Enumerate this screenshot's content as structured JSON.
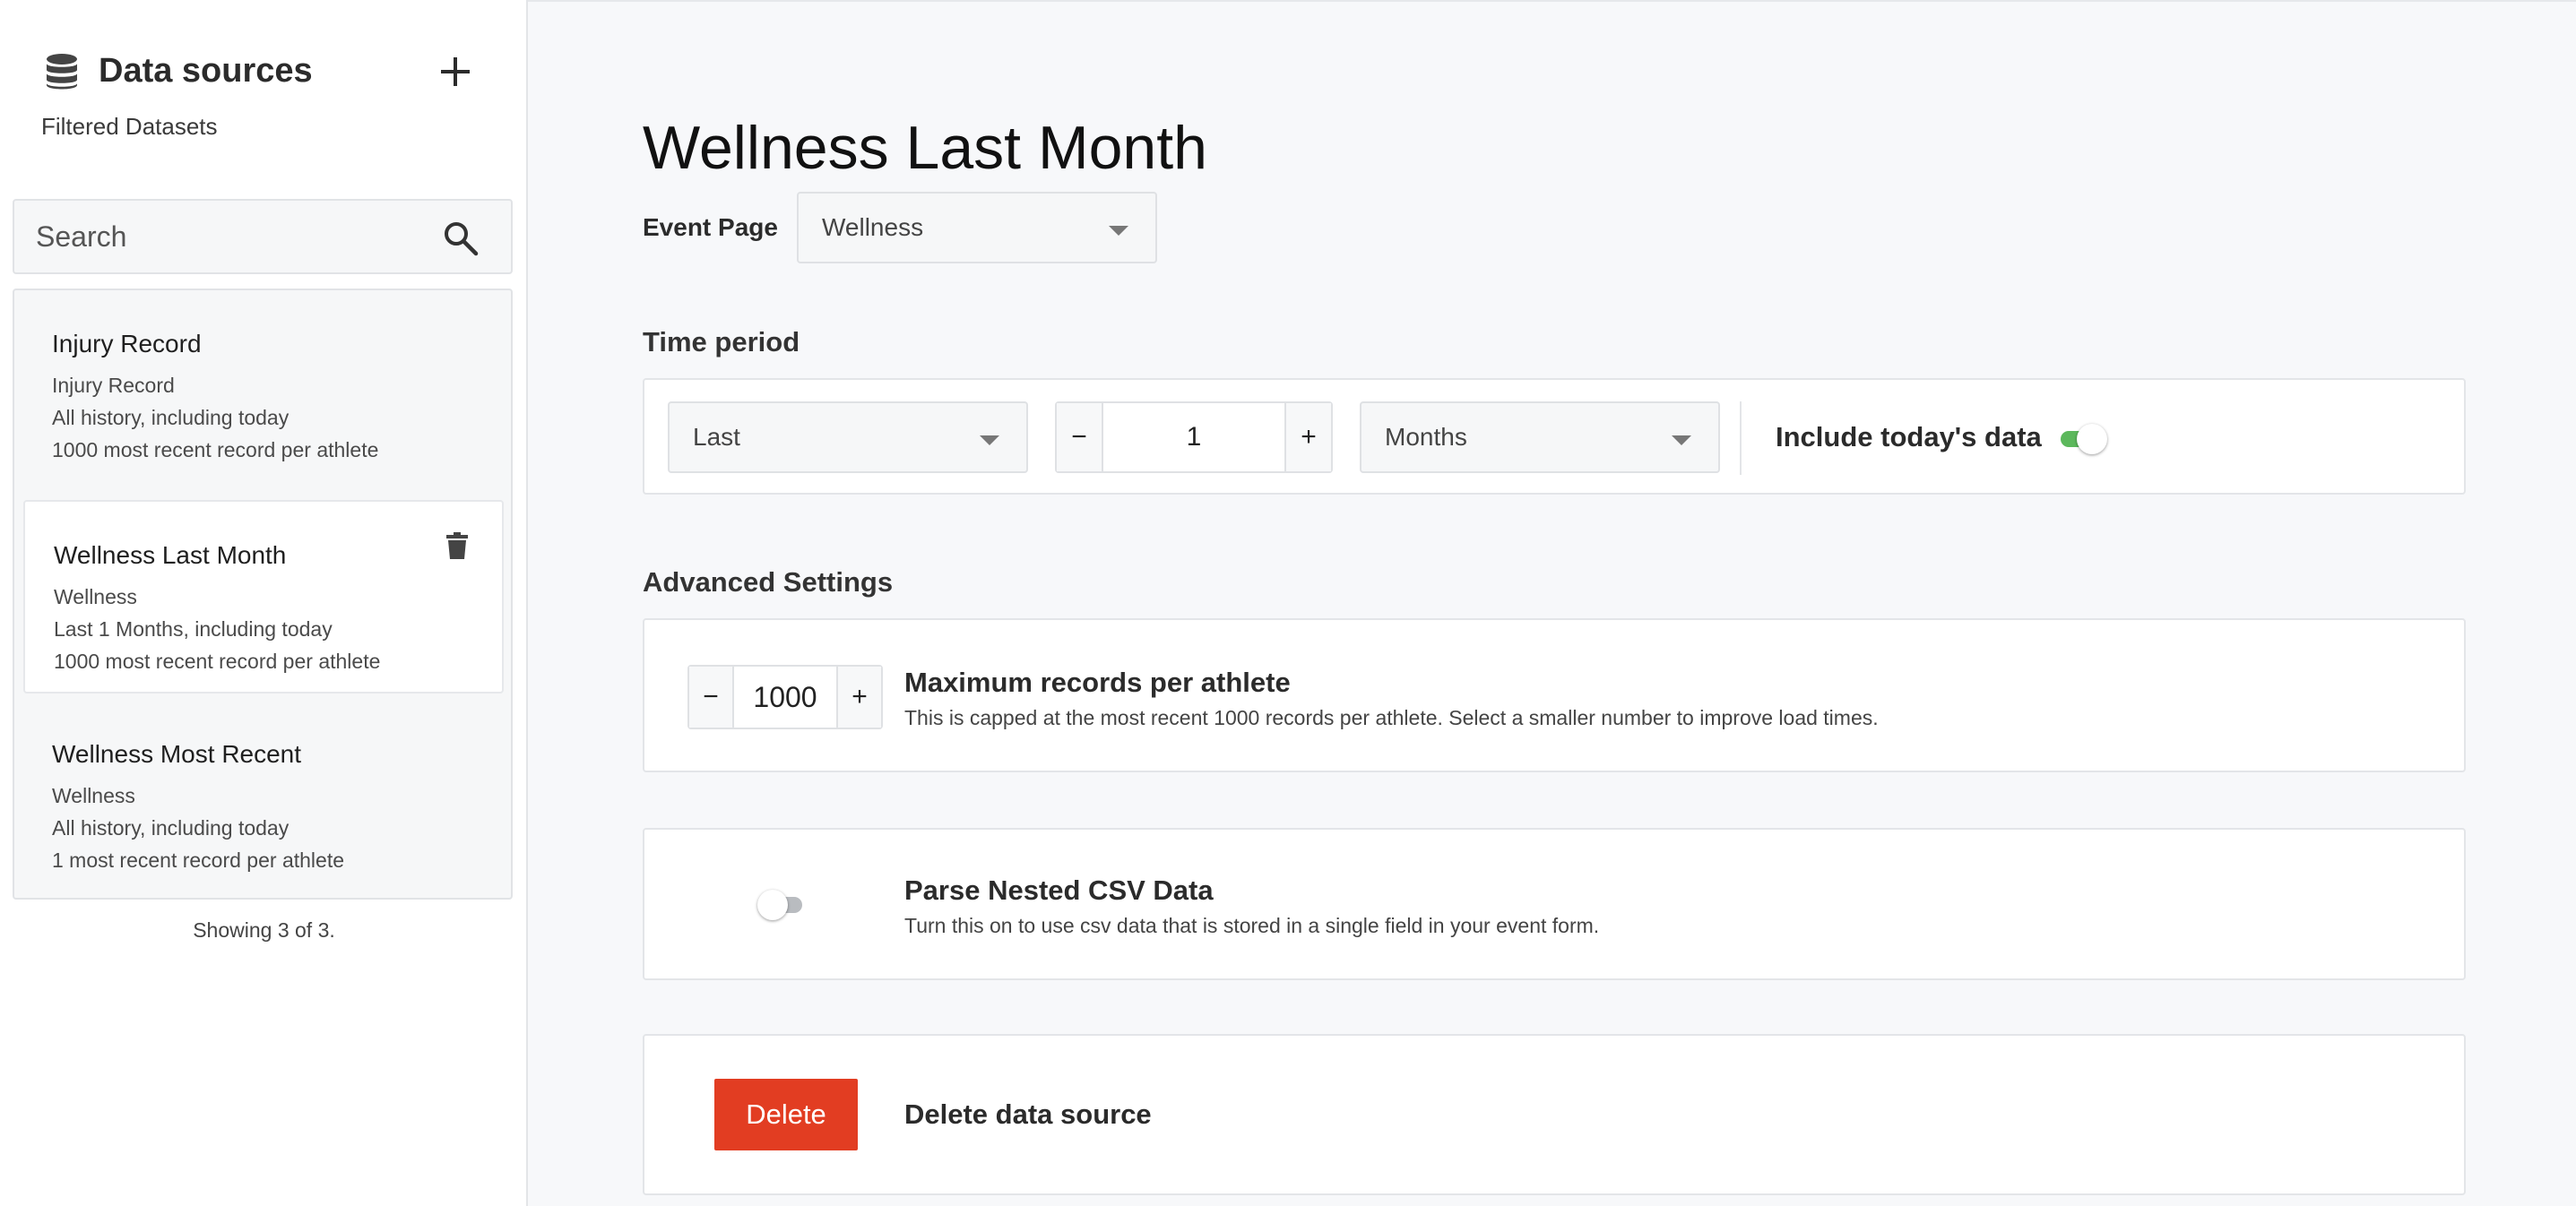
{
  "sidebar": {
    "title": "Data sources",
    "subtitle": "Filtered Datasets",
    "search_placeholder": "Search",
    "items": [
      {
        "name": "Injury Record",
        "event": "Injury Record",
        "period": "All history, including today",
        "records": "1000 most recent record per athlete"
      },
      {
        "name": "Wellness Last Month",
        "event": "Wellness",
        "period": "Last 1 Months, including today",
        "records": "1000 most recent record per athlete"
      },
      {
        "name": "Wellness Most Recent",
        "event": "Wellness",
        "period": "All history, including today",
        "records": "1 most recent record per athlete"
      }
    ],
    "showing": "Showing 3 of 3."
  },
  "main": {
    "title": "Wellness Last Month",
    "event_page_label": "Event Page",
    "event_page_value": "Wellness",
    "time_period": {
      "label": "Time period",
      "relation": "Last",
      "amount": "1",
      "unit": "Months",
      "include_today_label": "Include today's data",
      "include_today": true
    },
    "advanced": {
      "label": "Advanced Settings",
      "max_records": {
        "value": "1000",
        "title": "Maximum records per athlete",
        "description": "This is capped at the most recent 1000 records per athlete. Select a smaller number to improve load times."
      },
      "parse_csv": {
        "enabled": false,
        "title": "Parse Nested CSV Data",
        "description": "Turn this on to use csv data that is stored in a single field in your event form."
      },
      "delete": {
        "button_label": "Delete",
        "label": "Delete data source"
      }
    }
  },
  "stepper": {
    "minus": "−",
    "plus": "+"
  },
  "colors": {
    "accent_delete": "#e23d22",
    "toggle_on": "#5cb85c",
    "toggle_off": "#b9bcc0",
    "background": "#f7f8fa"
  },
  "icons": {
    "sidebar_title": "database-icon",
    "add": "plus-icon",
    "search": "search-icon",
    "item_action": "trash-icon",
    "select": "caret-down-icon"
  }
}
